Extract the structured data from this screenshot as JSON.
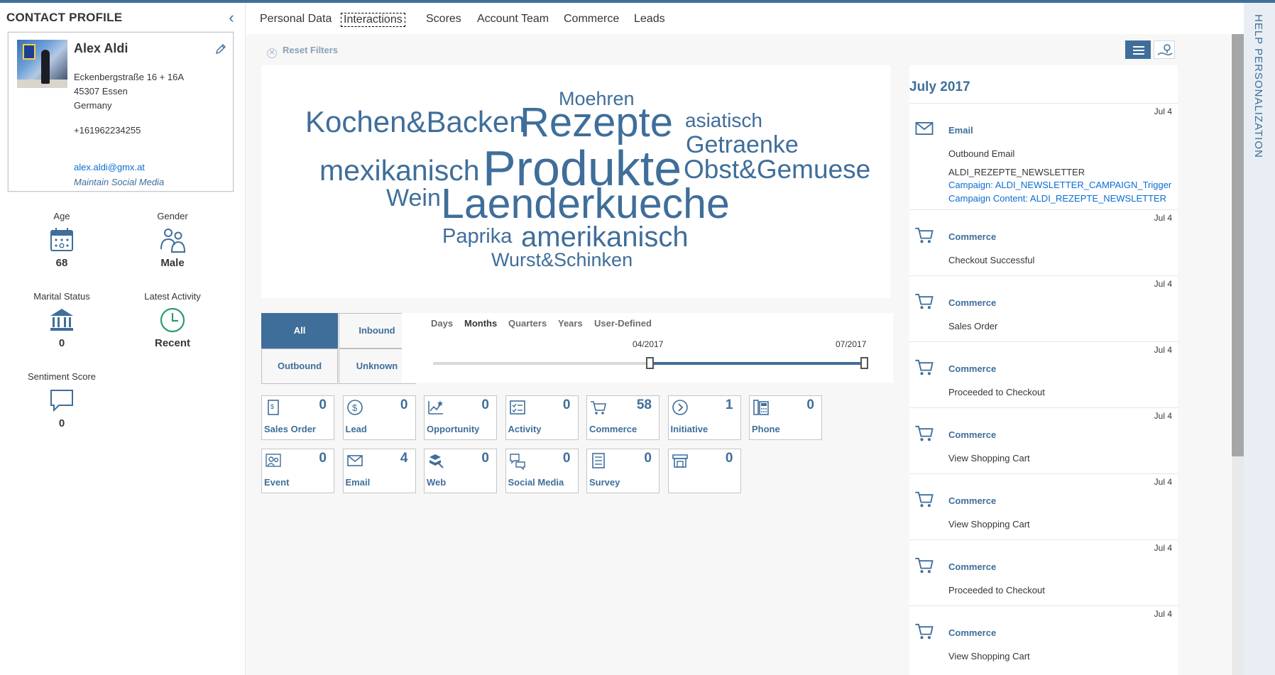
{
  "profile": {
    "header": "CONTACT PROFILE",
    "name": "Alex Aldi",
    "street": "Eckenbergstraße 16 + 16A",
    "city": "45307 Essen",
    "country": "Germany",
    "phone": "+161962234255",
    "email": "alex.aldi@gmx.at",
    "social_link": "Maintain Social Media"
  },
  "stats": {
    "age": {
      "label": "Age",
      "value": "68",
      "icon": "calendar-icon"
    },
    "gender": {
      "label": "Gender",
      "value": "Male",
      "icon": "people-icon"
    },
    "marital": {
      "label": "Marital Status",
      "value": "0",
      "icon": "institution-icon"
    },
    "activity": {
      "label": "Latest Activity",
      "value": "Recent",
      "icon": "clock-icon"
    },
    "sentiment": {
      "label": "Sentiment Score",
      "value": "0",
      "icon": "speech-bubble-icon"
    }
  },
  "tabs": [
    "Personal Data",
    "Interactions",
    "Scores",
    "Account Team",
    "Commerce",
    "Leads"
  ],
  "active_tab": "Interactions",
  "reset_filters": "Reset Filters",
  "word_cloud": [
    "Moehren",
    "Kochen&Backen",
    "Rezepte",
    "asiatisch",
    "Getraenke",
    "mexikanisch",
    "Produkte",
    "Obst&Gemuese",
    "Wein",
    "Laenderkueche",
    "Paprika",
    "amerikanisch",
    "Wurst&Schinken"
  ],
  "direction_filter": {
    "all": "All",
    "inbound": "Inbound",
    "outbound": "Outbound",
    "unknown": "Unknown",
    "selected": "All"
  },
  "timeline": {
    "options": [
      "Days",
      "Months",
      "Quarters",
      "Years",
      "User-Defined"
    ],
    "selected": "Months",
    "start_label": "04/2017",
    "end_label": "07/2017",
    "range_start_fraction": 0.5,
    "range_end_fraction": 1.0
  },
  "tiles": [
    {
      "label": "Sales Order",
      "count": "0",
      "icon": "sales-order-icon"
    },
    {
      "label": "Lead",
      "count": "0",
      "icon": "dollar-icon"
    },
    {
      "label": "Opportunity",
      "count": "0",
      "icon": "opportunity-chart-icon"
    },
    {
      "label": "Activity",
      "count": "0",
      "icon": "checklist-icon"
    },
    {
      "label": "Commerce",
      "count": "58",
      "icon": "cart-icon"
    },
    {
      "label": "Initiative",
      "count": "1",
      "icon": "arrow-circle-icon"
    },
    {
      "label": "Phone",
      "count": "0",
      "icon": "phone-icon"
    },
    {
      "label": "Event",
      "count": "0",
      "icon": "event-people-icon"
    },
    {
      "label": "Email",
      "count": "4",
      "icon": "envelope-icon"
    },
    {
      "label": "Web",
      "count": "0",
      "icon": "web-icon"
    },
    {
      "label": "Social Media",
      "count": "0",
      "icon": "chat-icon"
    },
    {
      "label": "Survey",
      "count": "0",
      "icon": "survey-icon"
    },
    {
      "label": "",
      "count": "0",
      "icon": "store-icon"
    }
  ],
  "feed": {
    "month": "July 2017",
    "items": [
      {
        "date": "Jul 4",
        "type": "Email",
        "icon": "envelope-icon",
        "desc": "Outbound Email",
        "extra": "ALDI_REZEPTE_NEWSLETTER",
        "link1": "Campaign: ALDI_NEWSLETTER_CAMPAIGN_Trigger",
        "link2": "Campaign Content: ALDI_REZEPTE_NEWSLETTER"
      },
      {
        "date": "Jul 4",
        "type": "Commerce",
        "icon": "cart-icon",
        "desc": "Checkout Successful"
      },
      {
        "date": "Jul 4",
        "type": "Commerce",
        "icon": "cart-icon",
        "desc": "Sales Order"
      },
      {
        "date": "Jul 4",
        "type": "Commerce",
        "icon": "cart-icon",
        "desc": "Proceeded to Checkout"
      },
      {
        "date": "Jul 4",
        "type": "Commerce",
        "icon": "cart-icon",
        "desc": "View Shopping Cart"
      },
      {
        "date": "Jul 4",
        "type": "Commerce",
        "icon": "cart-icon",
        "desc": "View Shopping Cart"
      },
      {
        "date": "Jul 4",
        "type": "Commerce",
        "icon": "cart-icon",
        "desc": "Proceeded to Checkout"
      },
      {
        "date": "Jul 4",
        "type": "Commerce",
        "icon": "cart-icon",
        "desc": "View Shopping Cart"
      }
    ]
  },
  "help_label": "HELP   PERSONALIZATION",
  "colors": {
    "accent": "#3f6e9a",
    "link": "#0a6ed1",
    "text": "#32363a"
  }
}
